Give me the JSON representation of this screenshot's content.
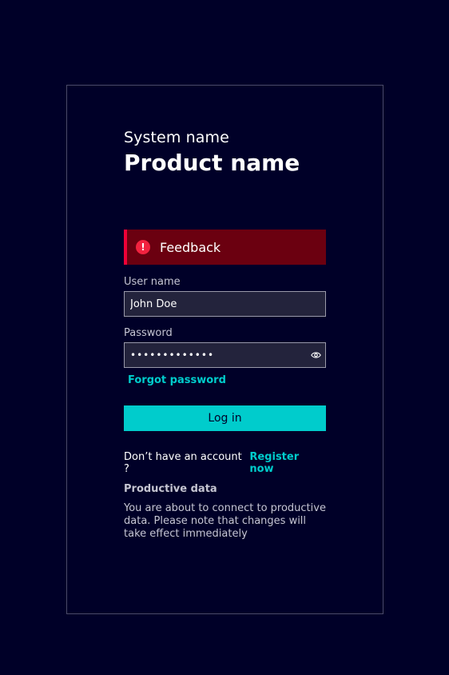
{
  "header": {
    "system_name": "System name",
    "product_name": "Product name"
  },
  "feedback": {
    "icon": "exclamation-circle-icon",
    "icon_glyph": "!",
    "text": "Feedback",
    "color": "#6b0010",
    "accent": "#ef0137"
  },
  "form": {
    "username_label": "User name",
    "username_value": "John Doe",
    "password_label": "Password",
    "password_value": "•••••••••••••",
    "password_toggle_icon": "eye-icon",
    "forgot_password": "Forgot password",
    "login_label": "Log in"
  },
  "register": {
    "question": "Don’t have an account ?",
    "link": "Register now"
  },
  "notice": {
    "title": "Productive data",
    "text": "You are about to connect to productive data. Please note that changes will take effect immediately"
  },
  "colors": {
    "background": "#000028",
    "accent": "#00cccc",
    "error": "#6b0010"
  }
}
